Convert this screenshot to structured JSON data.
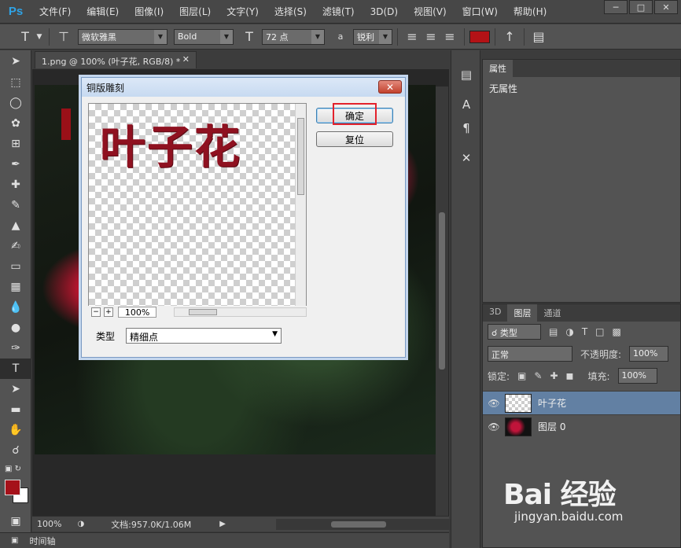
{
  "app": {
    "logo": "Ps"
  },
  "menu": [
    "文件(F)",
    "编辑(E)",
    "图像(I)",
    "图层(L)",
    "文字(Y)",
    "选择(S)",
    "滤镜(T)",
    "3D(D)",
    "视图(V)",
    "窗口(W)",
    "帮助(H)"
  ],
  "options": {
    "font_family": "微软雅黑",
    "font_style": "Bold",
    "font_size": "72 点",
    "antialias": "锐利",
    "text_color": "#b31216"
  },
  "document": {
    "tab_title": "1.png @ 100% (叶子花, RGB/8) *",
    "zoom": "100%",
    "doc_info": "文档:957.0K/1.06M"
  },
  "timeline": {
    "label": "时间轴"
  },
  "properties": {
    "tab": "属性",
    "empty_text": "无属性"
  },
  "layers_panel": {
    "tabs": [
      "3D",
      "图层",
      "通道"
    ],
    "kind_filter": "类型",
    "blend_mode": "正常",
    "opacity_label": "不透明度:",
    "opacity_value": "100%",
    "lock_label": "锁定:",
    "fill_label": "填充:",
    "fill_value": "100%",
    "layers": [
      {
        "name": "叶子花",
        "selected": true
      },
      {
        "name": "图层 0",
        "selected": false
      }
    ]
  },
  "dialog": {
    "title": "铜版雕刻",
    "preview_text": "叶子花",
    "preview_zoom": "100%",
    "ok_button": "确定",
    "reset_button": "复位",
    "type_label": "类型",
    "type_value": "精细点"
  },
  "watermark": {
    "logo": "Bai 经验",
    "url": "jingyan.baidu.com"
  }
}
